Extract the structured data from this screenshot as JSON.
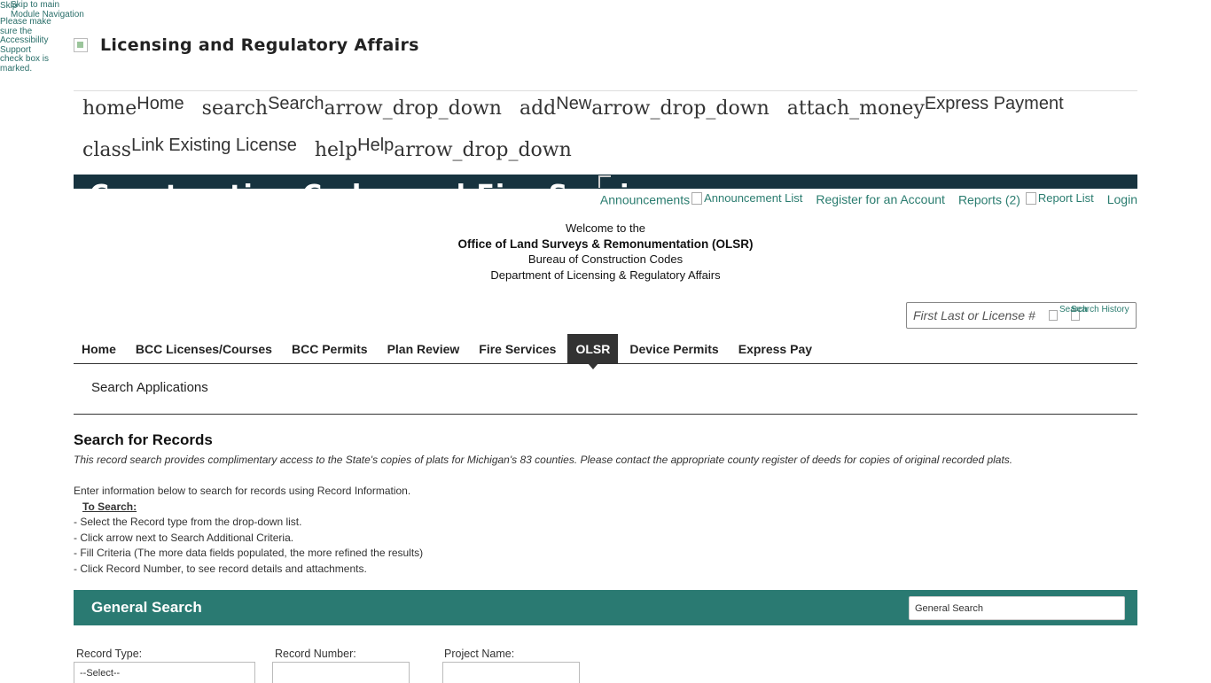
{
  "skip": {
    "skip_link": "Skip to main",
    "module_nav": "Module Navigation",
    "img_alt": "Skip",
    "accessibility_note": "Please make sure the Accessibility Support check box is marked."
  },
  "brand": {
    "title": "Licensing and Regulatory Affairs"
  },
  "main_nav": {
    "row1": [
      {
        "icon": "home",
        "label": "Home",
        "arrow": ""
      },
      {
        "icon": "search",
        "label": "Search",
        "arrow": "arrow_drop_down"
      },
      {
        "icon": "add",
        "label": "New",
        "arrow": "arrow_drop_down"
      },
      {
        "icon": "attach_money",
        "label": "Express Payment",
        "arrow": ""
      }
    ],
    "row2": [
      {
        "icon": "class",
        "label": "Link Existing License",
        "arrow": ""
      },
      {
        "icon": "help",
        "label": "Help",
        "arrow": "arrow_drop_down"
      }
    ]
  },
  "banner": {
    "text": "Construction Codes and Fire Services"
  },
  "util_links": {
    "announcements": "Announcements",
    "announcement_list_alt": "Announcement List",
    "register": "Register for an Account",
    "reports": "Reports (2)",
    "report_list_alt": "Report List",
    "login": "Login"
  },
  "welcome": {
    "line1": "Welcome to the",
    "line2": "Office of Land Surveys & Remonumentation (OLSR)",
    "line3": "Bureau of Construction Codes",
    "line4": "Department of Licensing & Regulatory Affairs"
  },
  "global_search": {
    "placeholder": "First Last or License #",
    "search_alt": "Search",
    "history_alt": "Search History"
  },
  "tabs": [
    {
      "label": "Home",
      "active": false
    },
    {
      "label": "BCC Licenses/Courses",
      "active": false
    },
    {
      "label": "BCC Permits",
      "active": false
    },
    {
      "label": "Plan Review",
      "active": false
    },
    {
      "label": "Fire Services",
      "active": false
    },
    {
      "label": "OLSR",
      "active": true
    },
    {
      "label": "Device Permits",
      "active": false
    },
    {
      "label": "Express Pay",
      "active": false
    }
  ],
  "subnav": {
    "search_applications": "Search Applications"
  },
  "page": {
    "title": "Search for Records",
    "description": "This record search provides complimentary access to the State's copies of plats for Michigan's 83 counties. Please contact the appropriate county register of deeds for copies of original recorded plats."
  },
  "instructions": {
    "intro": "Enter information below to search for records using Record Information.",
    "to_search": "To Search:",
    "steps": [
      "- Select the Record type from the drop-down list.",
      "- Click arrow next to Search Additional Criteria.",
      "- Fill Criteria (The more data fields populated, the more refined the results)",
      "- Click Record Number, to see record details and attachments."
    ]
  },
  "general_search": {
    "title": "General Search",
    "selected": "General Search"
  },
  "form": {
    "record_type_label": "Record Type:",
    "record_type_value": "--Select--",
    "record_number_label": "Record Number:",
    "record_number_value": "",
    "project_name_label": "Project Name:",
    "project_name_value": ""
  },
  "colors": {
    "teal_bar": "#2a7a72",
    "link": "#2a7c6f",
    "banner": "#17333f",
    "active_tab": "#333333"
  }
}
